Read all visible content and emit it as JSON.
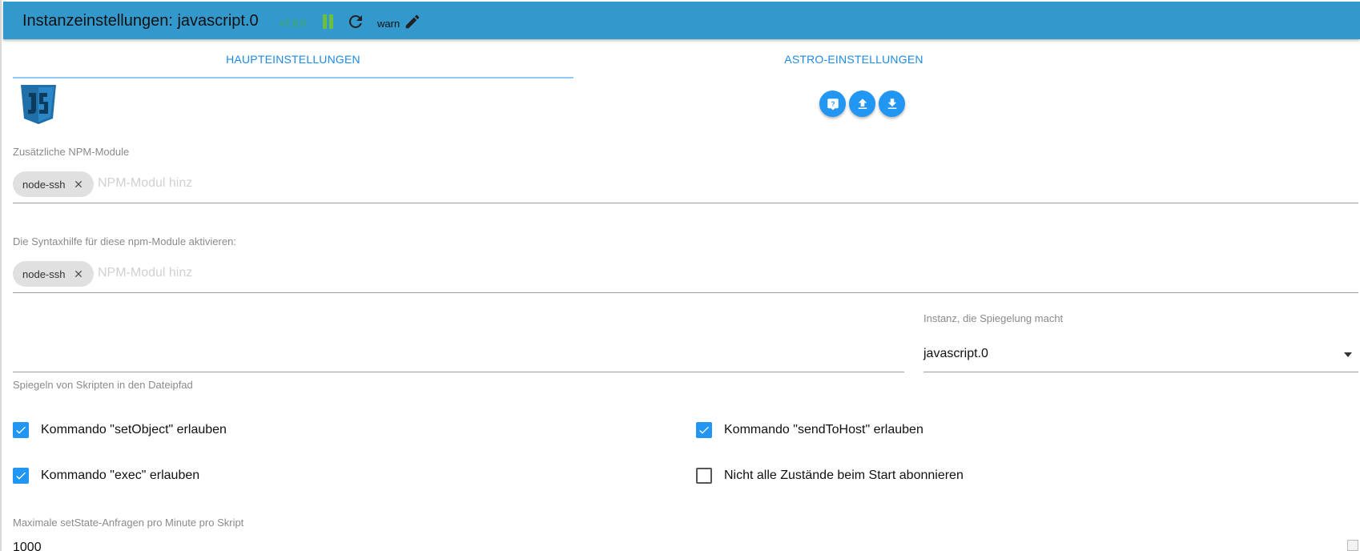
{
  "header": {
    "title": "Instanzeinstellungen: javascript.0",
    "version": "v7.8.0",
    "log_level": "warn"
  },
  "tabs": [
    {
      "label": "HAUPTEINSTELLUNGEN",
      "active": true
    },
    {
      "label": "ASTRO-EINSTELLUNGEN",
      "active": false
    }
  ],
  "logo_icon": "javascript-logo-icon",
  "action_icons": [
    "help-icon",
    "upload-icon",
    "download-icon"
  ],
  "npm_modules": {
    "label": "Zusätzliche NPM-Module",
    "chips": [
      "node-ssh"
    ],
    "placeholder": "NPM-Modul hinz"
  },
  "syntax_help": {
    "label": "Die Syntaxhilfe für diese npm-Module aktivieren:",
    "chips": [
      "node-ssh"
    ],
    "placeholder": "NPM-Modul hinz"
  },
  "mirror": {
    "path_label": "Spiegeln von Skripten in den Dateipfad",
    "path_value": "",
    "instance_label": "Instanz, die Spiegelung macht",
    "instance_value": "javascript.0"
  },
  "checkboxes": [
    {
      "label": "Kommando \"setObject\" erlauben",
      "checked": true
    },
    {
      "label": "Kommando \"sendToHost\" erlauben",
      "checked": true
    },
    {
      "label": "Kommando \"exec\" erlauben",
      "checked": true
    },
    {
      "label": "Nicht alle Zustände beim Start abonnieren",
      "checked": false
    }
  ],
  "max_setstate": {
    "label": "Maximale setState-Anfragen pro Minute pro Skript",
    "value": "1000"
  },
  "colors": {
    "header_bg": "#3399cc",
    "accent": "#2196f3",
    "tab_text": "#1e88e5",
    "version_green": "#3fa84a"
  }
}
